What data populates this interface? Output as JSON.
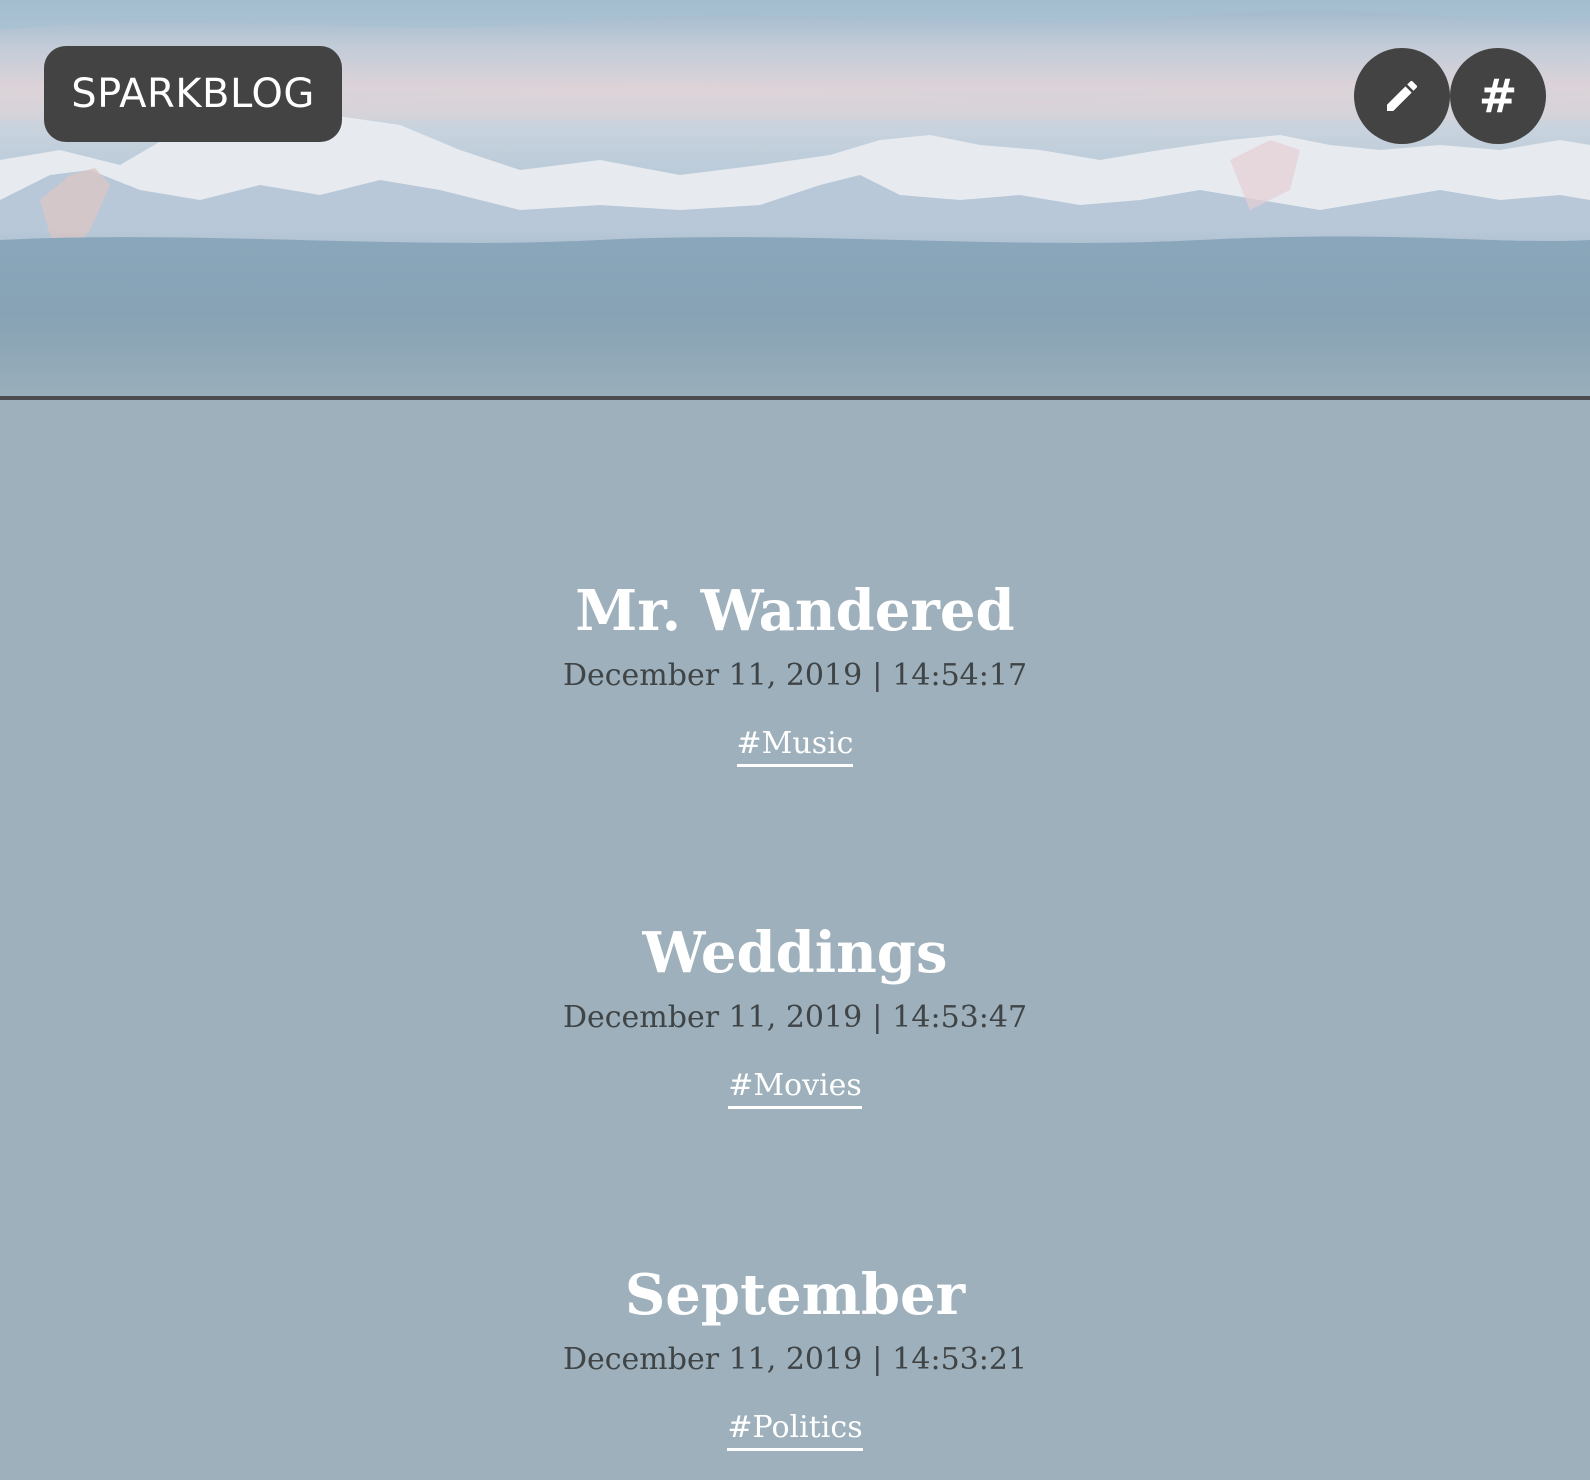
{
  "header": {
    "brand": "SPARKBLOG",
    "edit_icon": "pencil-icon",
    "tags_label": "#"
  },
  "posts": [
    {
      "title": "Mr. Wandered",
      "date": "December 11, 2019",
      "separator": "|",
      "time": "14:54:17",
      "tag": "#Music"
    },
    {
      "title": "Weddings",
      "date": "December 11, 2019",
      "separator": "|",
      "time": "14:53:47",
      "tag": "#Movies"
    },
    {
      "title": "September",
      "date": "December 11, 2019",
      "separator": "|",
      "time": "14:53:21",
      "tag": "#Politics"
    }
  ],
  "colors": {
    "background": "#9db0bb",
    "button": "#434343",
    "title": "#ffffff",
    "meta": "#3f4447"
  }
}
